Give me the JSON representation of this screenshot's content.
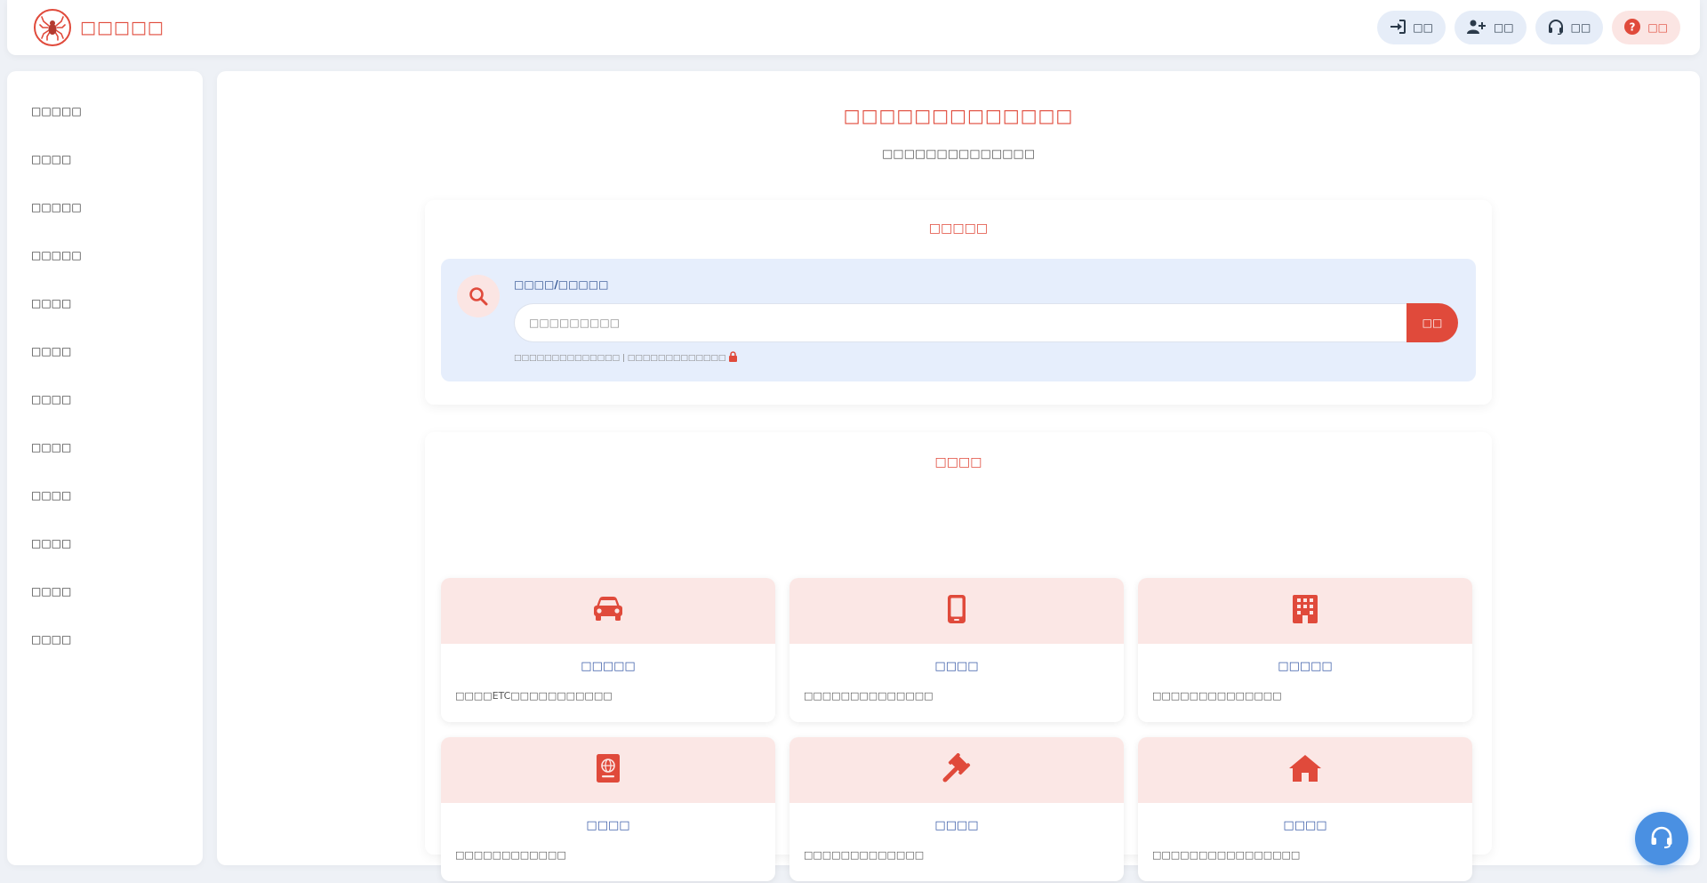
{
  "header": {
    "brand_name": "□□□□□",
    "nav": [
      {
        "label": "□□",
        "icon": "login-icon"
      },
      {
        "label": "□□",
        "icon": "user-plus-icon"
      },
      {
        "label": "□□",
        "icon": "headset-icon"
      },
      {
        "label": "□□",
        "icon": "question-circle-icon"
      }
    ]
  },
  "sidebar": {
    "items": [
      "□□□□□",
      "□□□□",
      "□□□□□",
      "□□□□□",
      "□□□□",
      "□□□□",
      "□□□□",
      "□□□□",
      "□□□□",
      "□□□□",
      "□□□□",
      "□□□□"
    ]
  },
  "main": {
    "title": "□□□□□□□□□□□□□",
    "subtitle": "□□□□□□□□□□□□□□"
  },
  "search": {
    "section_title": "□□□□□",
    "label": "□□□□/□□□□□",
    "placeholder": "□□□□□□□□□",
    "submit_label": "□□",
    "note": "□□□□□□□□□□□□□□ | □□□□□□□□□□□□□"
  },
  "services": {
    "section_title": "□□□□",
    "cards": [
      {
        "icon": "car-icon",
        "title": "□□□□□",
        "desc": "□□□□ETC□□□□□□□□□□□"
      },
      {
        "icon": "mobile-phone-icon",
        "title": "□□□□",
        "desc": "□□□□□□□□□□□□□□"
      },
      {
        "icon": "building-icon",
        "title": "□□□□□",
        "desc": "□□□□□□□□□□□□□□"
      },
      {
        "icon": "passport-icon",
        "title": "□□□□",
        "desc": "□□□□□□□□□□□□"
      },
      {
        "icon": "gavel-icon",
        "title": "□□□□",
        "desc": "□□□□□□□□□□□□□"
      },
      {
        "icon": "house-icon",
        "title": "□□□□",
        "desc": "□□□□□□□□□□□□□□□□"
      }
    ]
  },
  "colors": {
    "accent": "#e04a3b",
    "card_title": "#3b5ca8",
    "search_bg": "#e6eefc",
    "fab": "#4a90e2"
  },
  "support_fab_icon": "headset-icon"
}
